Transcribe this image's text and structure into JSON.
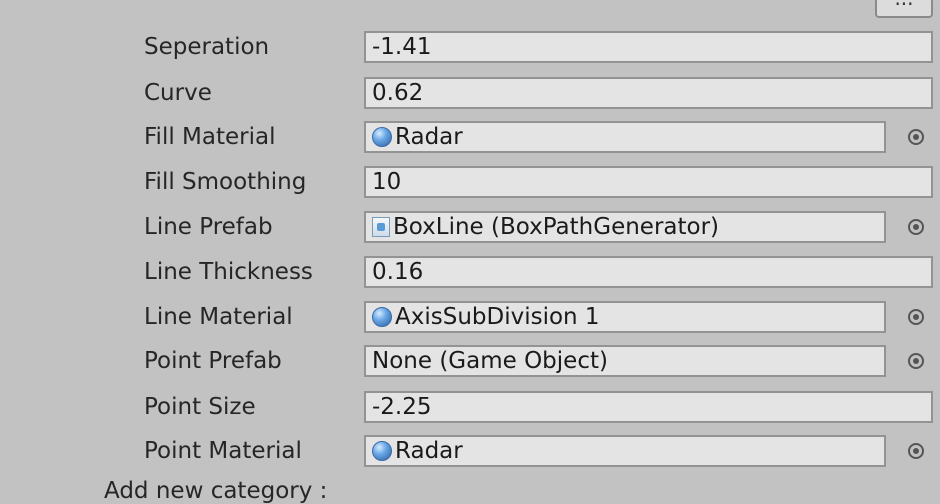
{
  "menu_button": {
    "label": "..."
  },
  "rows": [
    {
      "label": "Seperation",
      "value": "-1.41",
      "kind": "text"
    },
    {
      "label": "Curve",
      "value": "0.62",
      "kind": "text"
    },
    {
      "label": "Fill Material",
      "value": "Radar",
      "kind": "material"
    },
    {
      "label": "Fill Smoothing",
      "value": "10",
      "kind": "text"
    },
    {
      "label": "Line Prefab",
      "value": "BoxLine (BoxPathGenerator)",
      "kind": "prefab"
    },
    {
      "label": "Line Thickness",
      "value": "0.16",
      "kind": "text"
    },
    {
      "label": "Line Material",
      "value": "AxisSubDivision 1",
      "kind": "material"
    },
    {
      "label": "Point Prefab",
      "value": "None (Game Object)",
      "kind": "none"
    },
    {
      "label": "Point Size",
      "value": "-2.25",
      "kind": "text"
    },
    {
      "label": "Point Material",
      "value": "Radar",
      "kind": "material"
    }
  ],
  "footer": {
    "label": "Add new category :"
  },
  "icons": {
    "material": "material-sphere-icon",
    "prefab": "prefab-icon",
    "picker": "object-picker-icon"
  }
}
